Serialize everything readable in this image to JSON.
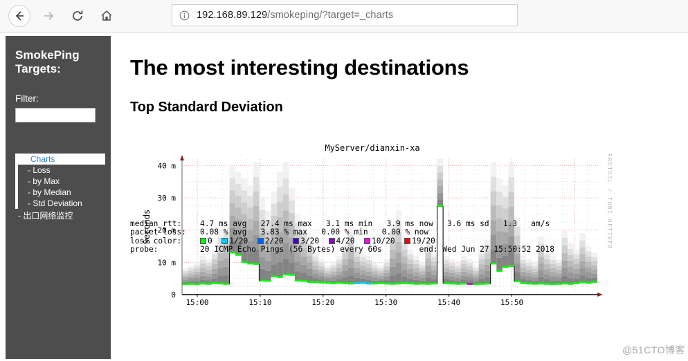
{
  "browser": {
    "back_label": "Back",
    "forward_label": "Forward",
    "reload_label": "Reload",
    "home_label": "Home",
    "info_label": "Site information",
    "url_host": "192.168.89.129",
    "url_path": "/smokeping/?target=_charts",
    "url_full": "192.168.89.129/smokeping/?target=_charts"
  },
  "sidebar": {
    "title": "SmokePing\nTargets:",
    "filter_label": "Filter:",
    "filter_value": "",
    "filter_placeholder": "",
    "nav": {
      "charts_label": "Charts",
      "sub_items": [
        {
          "label": "- Loss"
        },
        {
          "label": "- by Max"
        },
        {
          "label": "- by Median"
        },
        {
          "label": "- Std Deviation"
        }
      ],
      "extra_label": "- 出口网络监控"
    },
    "bg_color": "#4d4d4d",
    "active_text_color": "#2f7fd4"
  },
  "main": {
    "page_title": "The most interesting destinations",
    "section_title": "Top Standard Deviation"
  },
  "chart_data": {
    "type": "area",
    "title": "MyServer/dianxin-xa",
    "xlabel": "",
    "ylabel": "Seconds",
    "ylim": [
      0,
      0.042
    ],
    "ytick_labels": [
      "0",
      "10 m",
      "20 m",
      "30 m",
      "40 m"
    ],
    "ytick_values": [
      0,
      0.01,
      0.02,
      0.03,
      0.04
    ],
    "xtick_labels": [
      "15:00",
      "15:10",
      "15:20",
      "15:30",
      "15:40",
      "15:50"
    ],
    "xlim_labels": [
      "14:55",
      "15:52"
    ],
    "grid": true,
    "grid_color": "#e8a0a0",
    "median_color": "#00ff00",
    "smoke_color": "#808080",
    "legend_position": "below",
    "watermark": "RRDTOOL / TOBI OETIKER",
    "series": [
      {
        "name": "median rtt",
        "unit": "ms",
        "values": [
          3.2,
          3.3,
          3.2,
          3.4,
          3.3,
          3.5,
          3.4,
          3.3,
          13.0,
          12.3,
          10.0,
          9.6,
          9.5,
          4.3,
          4.2,
          5.6,
          5.4,
          6.2,
          6.1,
          4.3,
          4.2,
          3.9,
          3.8,
          3.7,
          3.6,
          3.5,
          3.6,
          3.5,
          3.4,
          3.5,
          3.6,
          3.4,
          3.4,
          3.5,
          3.4,
          3.3,
          3.4,
          3.5,
          3.4,
          3.3,
          3.4,
          3.3,
          3.4,
          27.4,
          3.5,
          3.4,
          3.3,
          3.4,
          3.3,
          3.2,
          3.3,
          3.4,
          9.6,
          7.3,
          8.5,
          8.8,
          4.1,
          3.5,
          3.4,
          3.3,
          3.4,
          3.3,
          3.2,
          3.3,
          3.4,
          3.3,
          3.5,
          3.8,
          3.6,
          3.9
        ]
      },
      {
        "name": "smoke band upper",
        "unit": "ms",
        "values": [
          8,
          9,
          10,
          12,
          11,
          14,
          20,
          22,
          40,
          38,
          36,
          34,
          41,
          30,
          26,
          32,
          38,
          41,
          33,
          25,
          22,
          18,
          13,
          11,
          9,
          10,
          12,
          17,
          21,
          15,
          13,
          12,
          10,
          9,
          11,
          22,
          26,
          18,
          14,
          12,
          10,
          17,
          13,
          42,
          12,
          11,
          10,
          12,
          11,
          9,
          14,
          17,
          41,
          36,
          34,
          41,
          24,
          12,
          11,
          10,
          18,
          14,
          12,
          11,
          20,
          16,
          14,
          19,
          15,
          13
        ]
      }
    ],
    "stats": {
      "row1_label": "median rtt:",
      "row1_values": "4.7 ms avg   27.4 ms max   3.1 ms min   3.9 ms now   3.6 ms sd   1.3   am/s",
      "rtt_avg": "4.7 ms avg",
      "rtt_max": "27.4 ms max",
      "rtt_min": "3.1 ms min",
      "rtt_now": "3.9 ms now",
      "rtt_sd": "3.6 ms sd",
      "rtt_am_s": "1.3    am/s",
      "row2_label": "packet loss:",
      "loss_avg": "0.08 % avg",
      "loss_max": "3.83 % max",
      "loss_min": "0.00 % min",
      "loss_now": "0.00 % now",
      "row3_label": "loss color:",
      "row4_label": "probe:",
      "probe_value": "20 ICMP Echo Pings (56 Bytes) every 60s",
      "end_label": "end: Wed Jun 27 15:50:52 2018"
    },
    "loss_legend": [
      {
        "label": "0",
        "color": "#00ff00"
      },
      {
        "label": "1/20",
        "color": "#00ccff"
      },
      {
        "label": "2/20",
        "color": "#0066ff"
      },
      {
        "label": "3/20",
        "color": "#4400cc"
      },
      {
        "label": "4/20",
        "color": "#8800cc"
      },
      {
        "label": "10/20",
        "color": "#ff00ff"
      },
      {
        "label": "19/20",
        "color": "#ff0000"
      }
    ]
  },
  "watermark": {
    "cto": "@51CTO博客"
  }
}
